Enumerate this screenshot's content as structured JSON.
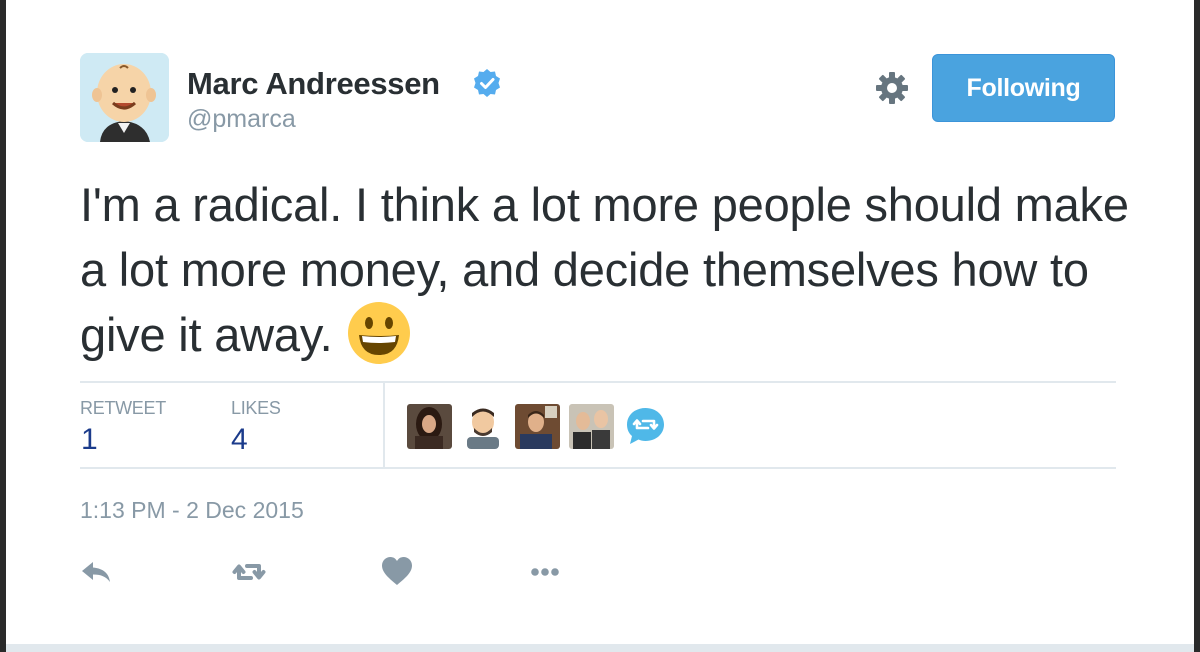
{
  "author": {
    "name": "Marc Andreessen",
    "handle": "@pmarca",
    "verified": true
  },
  "follow_button": {
    "label": "Following"
  },
  "tweet": {
    "text": "I'm a radical. I think a lot more people should make a lot more money, and decide themselves how to give it away.",
    "emoji": "grinning-face"
  },
  "stats": {
    "retweets_label": "RETWEET",
    "retweets_value": "1",
    "likes_label": "LIKES",
    "likes_value": "4"
  },
  "timestamp": "1:13 PM - 2 Dec 2015",
  "colors": {
    "accent": "#4aa3df",
    "text": "#292f33",
    "muted": "#8899a6",
    "stat_value": "#1b3b8b",
    "divider": "#e1e8ed"
  },
  "icons": {
    "settings": "gear-icon",
    "reply": "reply-icon",
    "retweet": "retweet-icon",
    "like": "heart-icon",
    "more": "more-icon"
  }
}
